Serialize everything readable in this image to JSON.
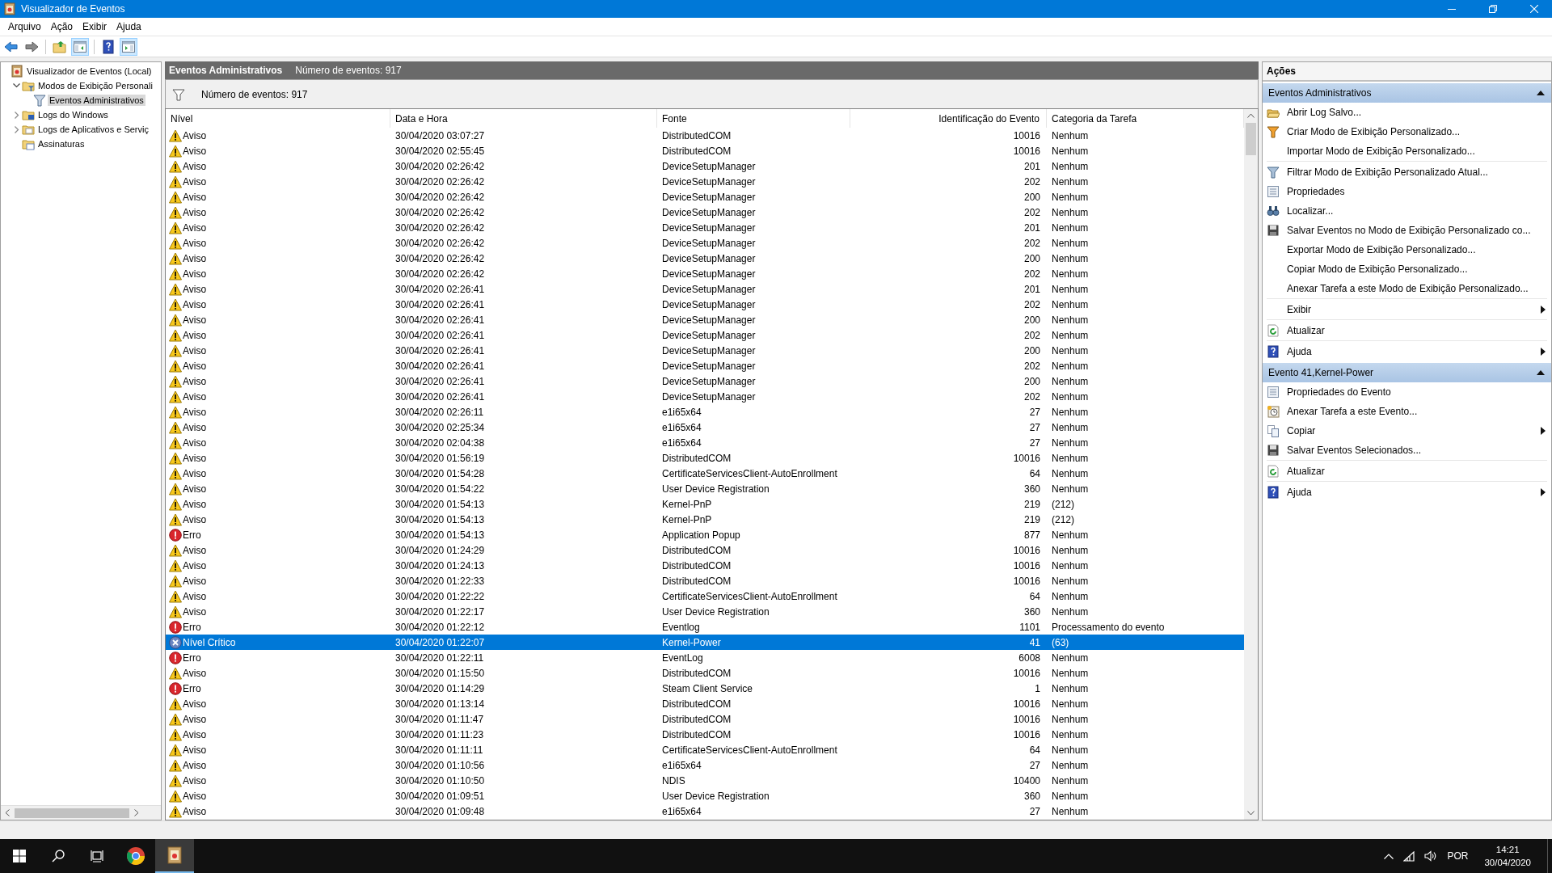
{
  "window": {
    "title": "Visualizador de Eventos"
  },
  "menu": [
    "Arquivo",
    "Ação",
    "Exibir",
    "Ajuda"
  ],
  "toolbar": [
    {
      "kind": "back",
      "pressed": false
    },
    {
      "kind": "forward",
      "pressed": false
    },
    {
      "kind": "folder-up",
      "pressed": false
    },
    {
      "kind": "tree-pane",
      "pressed": true
    },
    {
      "kind": "help",
      "pressed": false
    },
    {
      "kind": "action-pane",
      "pressed": true
    }
  ],
  "tree": [
    {
      "label": "Visualizador de Eventos (Local)",
      "kind": "viewer",
      "selected": false,
      "children": [
        {
          "label": "Modos de Exibição Personali",
          "kind": "folder-filter",
          "expanded": true,
          "selected": false,
          "children": [
            {
              "label": "Eventos Administrativos",
              "kind": "filter",
              "selected": true
            }
          ]
        },
        {
          "label": "Logs do Windows",
          "kind": "folder-windows",
          "expanded": false,
          "selected": false
        },
        {
          "label": "Logs de Aplicativos e Serviç",
          "kind": "folder",
          "expanded": false,
          "selected": false
        },
        {
          "label": "Assinaturas",
          "kind": "folder-subscriptions",
          "selected": false
        }
      ]
    }
  ],
  "center": {
    "title": "Eventos Administrativos",
    "count": "Número de eventos: 917",
    "filter_text": "Número de eventos: 917"
  },
  "table": {
    "columns": [
      "Nível",
      "Data e Hora",
      "Fonte",
      "Identificação do Evento",
      "Categoria da Tarefa"
    ],
    "rows": [
      {
        "kind": "warning",
        "level_text": "Aviso",
        "date": "30/04/2020 03:07:27",
        "source": "DistributedCOM",
        "event_id": "10016",
        "category": "Nenhum",
        "selected": false
      },
      {
        "kind": "warning",
        "level_text": "Aviso",
        "date": "30/04/2020 02:55:45",
        "source": "DistributedCOM",
        "event_id": "10016",
        "category": "Nenhum",
        "selected": false
      },
      {
        "kind": "warning",
        "level_text": "Aviso",
        "date": "30/04/2020 02:26:42",
        "source": "DeviceSetupManager",
        "event_id": "201",
        "category": "Nenhum",
        "selected": false
      },
      {
        "kind": "warning",
        "level_text": "Aviso",
        "date": "30/04/2020 02:26:42",
        "source": "DeviceSetupManager",
        "event_id": "202",
        "category": "Nenhum",
        "selected": false
      },
      {
        "kind": "warning",
        "level_text": "Aviso",
        "date": "30/04/2020 02:26:42",
        "source": "DeviceSetupManager",
        "event_id": "200",
        "category": "Nenhum",
        "selected": false
      },
      {
        "kind": "warning",
        "level_text": "Aviso",
        "date": "30/04/2020 02:26:42",
        "source": "DeviceSetupManager",
        "event_id": "202",
        "category": "Nenhum",
        "selected": false
      },
      {
        "kind": "warning",
        "level_text": "Aviso",
        "date": "30/04/2020 02:26:42",
        "source": "DeviceSetupManager",
        "event_id": "201",
        "category": "Nenhum",
        "selected": false
      },
      {
        "kind": "warning",
        "level_text": "Aviso",
        "date": "30/04/2020 02:26:42",
        "source": "DeviceSetupManager",
        "event_id": "202",
        "category": "Nenhum",
        "selected": false
      },
      {
        "kind": "warning",
        "level_text": "Aviso",
        "date": "30/04/2020 02:26:42",
        "source": "DeviceSetupManager",
        "event_id": "200",
        "category": "Nenhum",
        "selected": false
      },
      {
        "kind": "warning",
        "level_text": "Aviso",
        "date": "30/04/2020 02:26:42",
        "source": "DeviceSetupManager",
        "event_id": "202",
        "category": "Nenhum",
        "selected": false
      },
      {
        "kind": "warning",
        "level_text": "Aviso",
        "date": "30/04/2020 02:26:41",
        "source": "DeviceSetupManager",
        "event_id": "201",
        "category": "Nenhum",
        "selected": false
      },
      {
        "kind": "warning",
        "level_text": "Aviso",
        "date": "30/04/2020 02:26:41",
        "source": "DeviceSetupManager",
        "event_id": "202",
        "category": "Nenhum",
        "selected": false
      },
      {
        "kind": "warning",
        "level_text": "Aviso",
        "date": "30/04/2020 02:26:41",
        "source": "DeviceSetupManager",
        "event_id": "200",
        "category": "Nenhum",
        "selected": false
      },
      {
        "kind": "warning",
        "level_text": "Aviso",
        "date": "30/04/2020 02:26:41",
        "source": "DeviceSetupManager",
        "event_id": "202",
        "category": "Nenhum",
        "selected": false
      },
      {
        "kind": "warning",
        "level_text": "Aviso",
        "date": "30/04/2020 02:26:41",
        "source": "DeviceSetupManager",
        "event_id": "200",
        "category": "Nenhum",
        "selected": false
      },
      {
        "kind": "warning",
        "level_text": "Aviso",
        "date": "30/04/2020 02:26:41",
        "source": "DeviceSetupManager",
        "event_id": "202",
        "category": "Nenhum",
        "selected": false
      },
      {
        "kind": "warning",
        "level_text": "Aviso",
        "date": "30/04/2020 02:26:41",
        "source": "DeviceSetupManager",
        "event_id": "200",
        "category": "Nenhum",
        "selected": false
      },
      {
        "kind": "warning",
        "level_text": "Aviso",
        "date": "30/04/2020 02:26:41",
        "source": "DeviceSetupManager",
        "event_id": "202",
        "category": "Nenhum",
        "selected": false
      },
      {
        "kind": "warning",
        "level_text": "Aviso",
        "date": "30/04/2020 02:26:11",
        "source": "e1i65x64",
        "event_id": "27",
        "category": "Nenhum",
        "selected": false
      },
      {
        "kind": "warning",
        "level_text": "Aviso",
        "date": "30/04/2020 02:25:34",
        "source": "e1i65x64",
        "event_id": "27",
        "category": "Nenhum",
        "selected": false
      },
      {
        "kind": "warning",
        "level_text": "Aviso",
        "date": "30/04/2020 02:04:38",
        "source": "e1i65x64",
        "event_id": "27",
        "category": "Nenhum",
        "selected": false
      },
      {
        "kind": "warning",
        "level_text": "Aviso",
        "date": "30/04/2020 01:56:19",
        "source": "DistributedCOM",
        "event_id": "10016",
        "category": "Nenhum",
        "selected": false
      },
      {
        "kind": "warning",
        "level_text": "Aviso",
        "date": "30/04/2020 01:54:28",
        "source": "CertificateServicesClient-AutoEnrollment",
        "event_id": "64",
        "category": "Nenhum",
        "selected": false
      },
      {
        "kind": "warning",
        "level_text": "Aviso",
        "date": "30/04/2020 01:54:22",
        "source": "User Device Registration",
        "event_id": "360",
        "category": "Nenhum",
        "selected": false
      },
      {
        "kind": "warning",
        "level_text": "Aviso",
        "date": "30/04/2020 01:54:13",
        "source": "Kernel-PnP",
        "event_id": "219",
        "category": "(212)",
        "selected": false
      },
      {
        "kind": "warning",
        "level_text": "Aviso",
        "date": "30/04/2020 01:54:13",
        "source": "Kernel-PnP",
        "event_id": "219",
        "category": "(212)",
        "selected": false
      },
      {
        "kind": "error",
        "level_text": "Erro",
        "date": "30/04/2020 01:54:13",
        "source": "Application Popup",
        "event_id": "877",
        "category": "Nenhum",
        "selected": false
      },
      {
        "kind": "warning",
        "level_text": "Aviso",
        "date": "30/04/2020 01:24:29",
        "source": "DistributedCOM",
        "event_id": "10016",
        "category": "Nenhum",
        "selected": false
      },
      {
        "kind": "warning",
        "level_text": "Aviso",
        "date": "30/04/2020 01:24:13",
        "source": "DistributedCOM",
        "event_id": "10016",
        "category": "Nenhum",
        "selected": false
      },
      {
        "kind": "warning",
        "level_text": "Aviso",
        "date": "30/04/2020 01:22:33",
        "source": "DistributedCOM",
        "event_id": "10016",
        "category": "Nenhum",
        "selected": false
      },
      {
        "kind": "warning",
        "level_text": "Aviso",
        "date": "30/04/2020 01:22:22",
        "source": "CertificateServicesClient-AutoEnrollment",
        "event_id": "64",
        "category": "Nenhum",
        "selected": false
      },
      {
        "kind": "warning",
        "level_text": "Aviso",
        "date": "30/04/2020 01:22:17",
        "source": "User Device Registration",
        "event_id": "360",
        "category": "Nenhum",
        "selected": false
      },
      {
        "kind": "error",
        "level_text": "Erro",
        "date": "30/04/2020 01:22:12",
        "source": "Eventlog",
        "event_id": "1101",
        "category": "Processamento do evento",
        "selected": false
      },
      {
        "kind": "critical",
        "level_text": "Nível Crítico",
        "date": "30/04/2020 01:22:07",
        "source": "Kernel-Power",
        "event_id": "41",
        "category": "(63)",
        "selected": true
      },
      {
        "kind": "error",
        "level_text": "Erro",
        "date": "30/04/2020 01:22:11",
        "source": "EventLog",
        "event_id": "6008",
        "category": "Nenhum",
        "selected": false
      },
      {
        "kind": "warning",
        "level_text": "Aviso",
        "date": "30/04/2020 01:15:50",
        "source": "DistributedCOM",
        "event_id": "10016",
        "category": "Nenhum",
        "selected": false
      },
      {
        "kind": "error",
        "level_text": "Erro",
        "date": "30/04/2020 01:14:29",
        "source": "Steam Client Service",
        "event_id": "1",
        "category": "Nenhum",
        "selected": false
      },
      {
        "kind": "warning",
        "level_text": "Aviso",
        "date": "30/04/2020 01:13:14",
        "source": "DistributedCOM",
        "event_id": "10016",
        "category": "Nenhum",
        "selected": false
      },
      {
        "kind": "warning",
        "level_text": "Aviso",
        "date": "30/04/2020 01:11:47",
        "source": "DistributedCOM",
        "event_id": "10016",
        "category": "Nenhum",
        "selected": false
      },
      {
        "kind": "warning",
        "level_text": "Aviso",
        "date": "30/04/2020 01:11:23",
        "source": "DistributedCOM",
        "event_id": "10016",
        "category": "Nenhum",
        "selected": false
      },
      {
        "kind": "warning",
        "level_text": "Aviso",
        "date": "30/04/2020 01:11:11",
        "source": "CertificateServicesClient-AutoEnrollment",
        "event_id": "64",
        "category": "Nenhum",
        "selected": false
      },
      {
        "kind": "warning",
        "level_text": "Aviso",
        "date": "30/04/2020 01:10:56",
        "source": "e1i65x64",
        "event_id": "27",
        "category": "Nenhum",
        "selected": false
      },
      {
        "kind": "warning",
        "level_text": "Aviso",
        "date": "30/04/2020 01:10:50",
        "source": "NDIS",
        "event_id": "10400",
        "category": "Nenhum",
        "selected": false
      },
      {
        "kind": "warning",
        "level_text": "Aviso",
        "date": "30/04/2020 01:09:51",
        "source": "User Device Registration",
        "event_id": "360",
        "category": "Nenhum",
        "selected": false
      },
      {
        "kind": "warning",
        "level_text": "Aviso",
        "date": "30/04/2020 01:09:48",
        "source": "e1i65x64",
        "event_id": "27",
        "category": "Nenhum",
        "selected": false
      }
    ]
  },
  "actions": {
    "title": "Ações",
    "sections": [
      {
        "title": "Eventos Administrativos",
        "expanded": true,
        "items": [
          {
            "kind": "open",
            "label": "Abrir Log Salvo...",
            "submenu": false,
            "divider_after": false
          },
          {
            "kind": "filter-create",
            "label": "Criar Modo de Exibição Personalizado...",
            "submenu": false,
            "divider_after": false
          },
          {
            "kind": "none",
            "label": "Importar Modo de Exibição Personalizado...",
            "submenu": false,
            "divider_after": true
          },
          {
            "kind": "filter",
            "label": "Filtrar Modo de Exibição Personalizado Atual...",
            "submenu": false,
            "divider_after": false
          },
          {
            "kind": "properties",
            "label": "Propriedades",
            "submenu": false,
            "divider_after": false
          },
          {
            "kind": "find",
            "label": "Localizar...",
            "submenu": false,
            "divider_after": false
          },
          {
            "kind": "save",
            "label": "Salvar Eventos no Modo de Exibição Personalizado co...",
            "submenu": false,
            "divider_after": false
          },
          {
            "kind": "none",
            "label": "Exportar Modo de Exibição Personalizado...",
            "submenu": false,
            "divider_after": false
          },
          {
            "kind": "none",
            "label": "Copiar Modo de Exibição Personalizado...",
            "submenu": false,
            "divider_after": false
          },
          {
            "kind": "none",
            "label": "Anexar Tarefa a este Modo de Exibição Personalizado...",
            "submenu": false,
            "divider_after": true
          },
          {
            "kind": "none",
            "label": "Exibir",
            "submenu": true,
            "divider_after": true
          },
          {
            "kind": "refresh",
            "label": "Atualizar",
            "submenu": false,
            "divider_after": true
          },
          {
            "kind": "help",
            "label": "Ajuda",
            "submenu": true,
            "divider_after": false
          }
        ]
      },
      {
        "title": "Evento 41,Kernel-Power",
        "expanded": true,
        "items": [
          {
            "kind": "properties",
            "label": "Propriedades do Evento",
            "submenu": false,
            "divider_after": false
          },
          {
            "kind": "task",
            "label": "Anexar Tarefa a este Evento...",
            "submenu": false,
            "divider_after": false
          },
          {
            "kind": "copy",
            "label": "Copiar",
            "submenu": true,
            "divider_after": false
          },
          {
            "kind": "save",
            "label": "Salvar Eventos Selecionados...",
            "submenu": false,
            "divider_after": true
          },
          {
            "kind": "refresh",
            "label": "Atualizar",
            "submenu": false,
            "divider_after": true
          },
          {
            "kind": "help",
            "label": "Ajuda",
            "submenu": true,
            "divider_after": false
          }
        ]
      }
    ]
  },
  "taskbar": {
    "apps": [
      {
        "kind": "start",
        "active": false
      },
      {
        "kind": "search",
        "active": false
      },
      {
        "kind": "task-view",
        "active": false
      },
      {
        "kind": "browser",
        "active": false
      },
      {
        "kind": "event-viewer",
        "active": true
      }
    ],
    "tray": {
      "language": "POR",
      "time": "14:21",
      "date": "30/04/2020"
    }
  }
}
